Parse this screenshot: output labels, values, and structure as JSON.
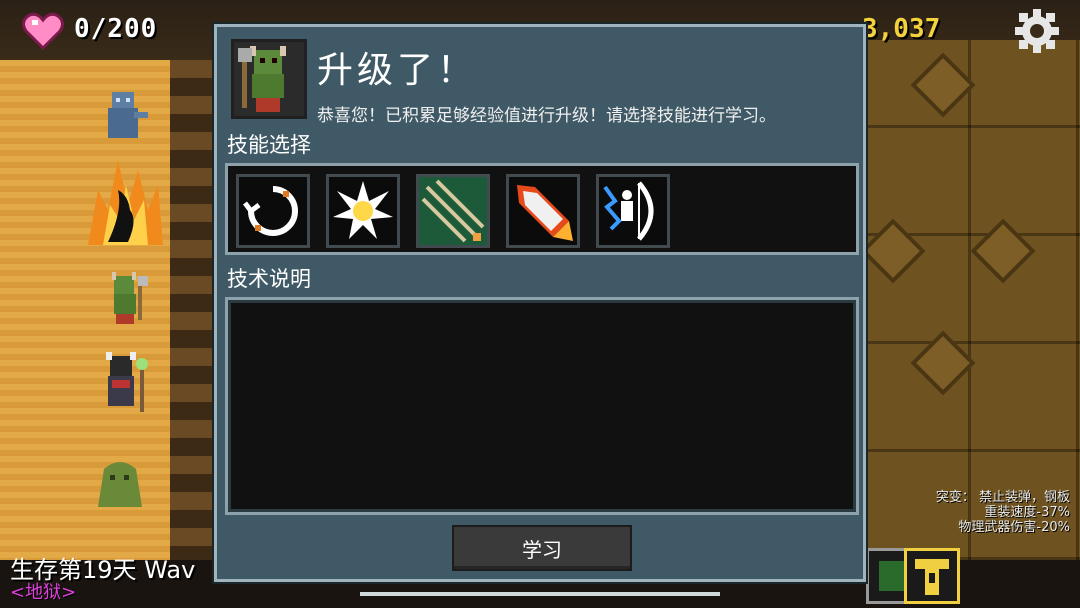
{
  "hud": {
    "hp": "0/200",
    "gold": "3,037",
    "icons": [
      "heart-icon",
      "gear-icon"
    ]
  },
  "bottom_hud": {
    "day_text": "生存第19天 Wav",
    "map_name": "<地狱>",
    "mutation_lines": [
      "突变： 禁止装弹，钢板",
      "重装速度-37%",
      "物理武器伤害-20%"
    ]
  },
  "dialog": {
    "title": "升级了！",
    "subtitle": "恭喜您！已积累足够经验值进行升级！请选择技能进行学习。",
    "skill_section_label": "技能选择",
    "desc_section_label": "技术说明",
    "description": "",
    "learn_button": "学习",
    "skills": [
      {
        "icon": "reload-ring-icon"
      },
      {
        "icon": "explosion-burst-icon"
      },
      {
        "icon": "arrow-volley-icon"
      },
      {
        "icon": "fire-rocket-icon"
      },
      {
        "icon": "lightning-bow-icon"
      }
    ]
  },
  "colors": {
    "dialog_bg": "#3f5a66",
    "dialog_border": "#9fb4bd",
    "gold": "#f4d23c",
    "map_name": "#e040e0"
  }
}
